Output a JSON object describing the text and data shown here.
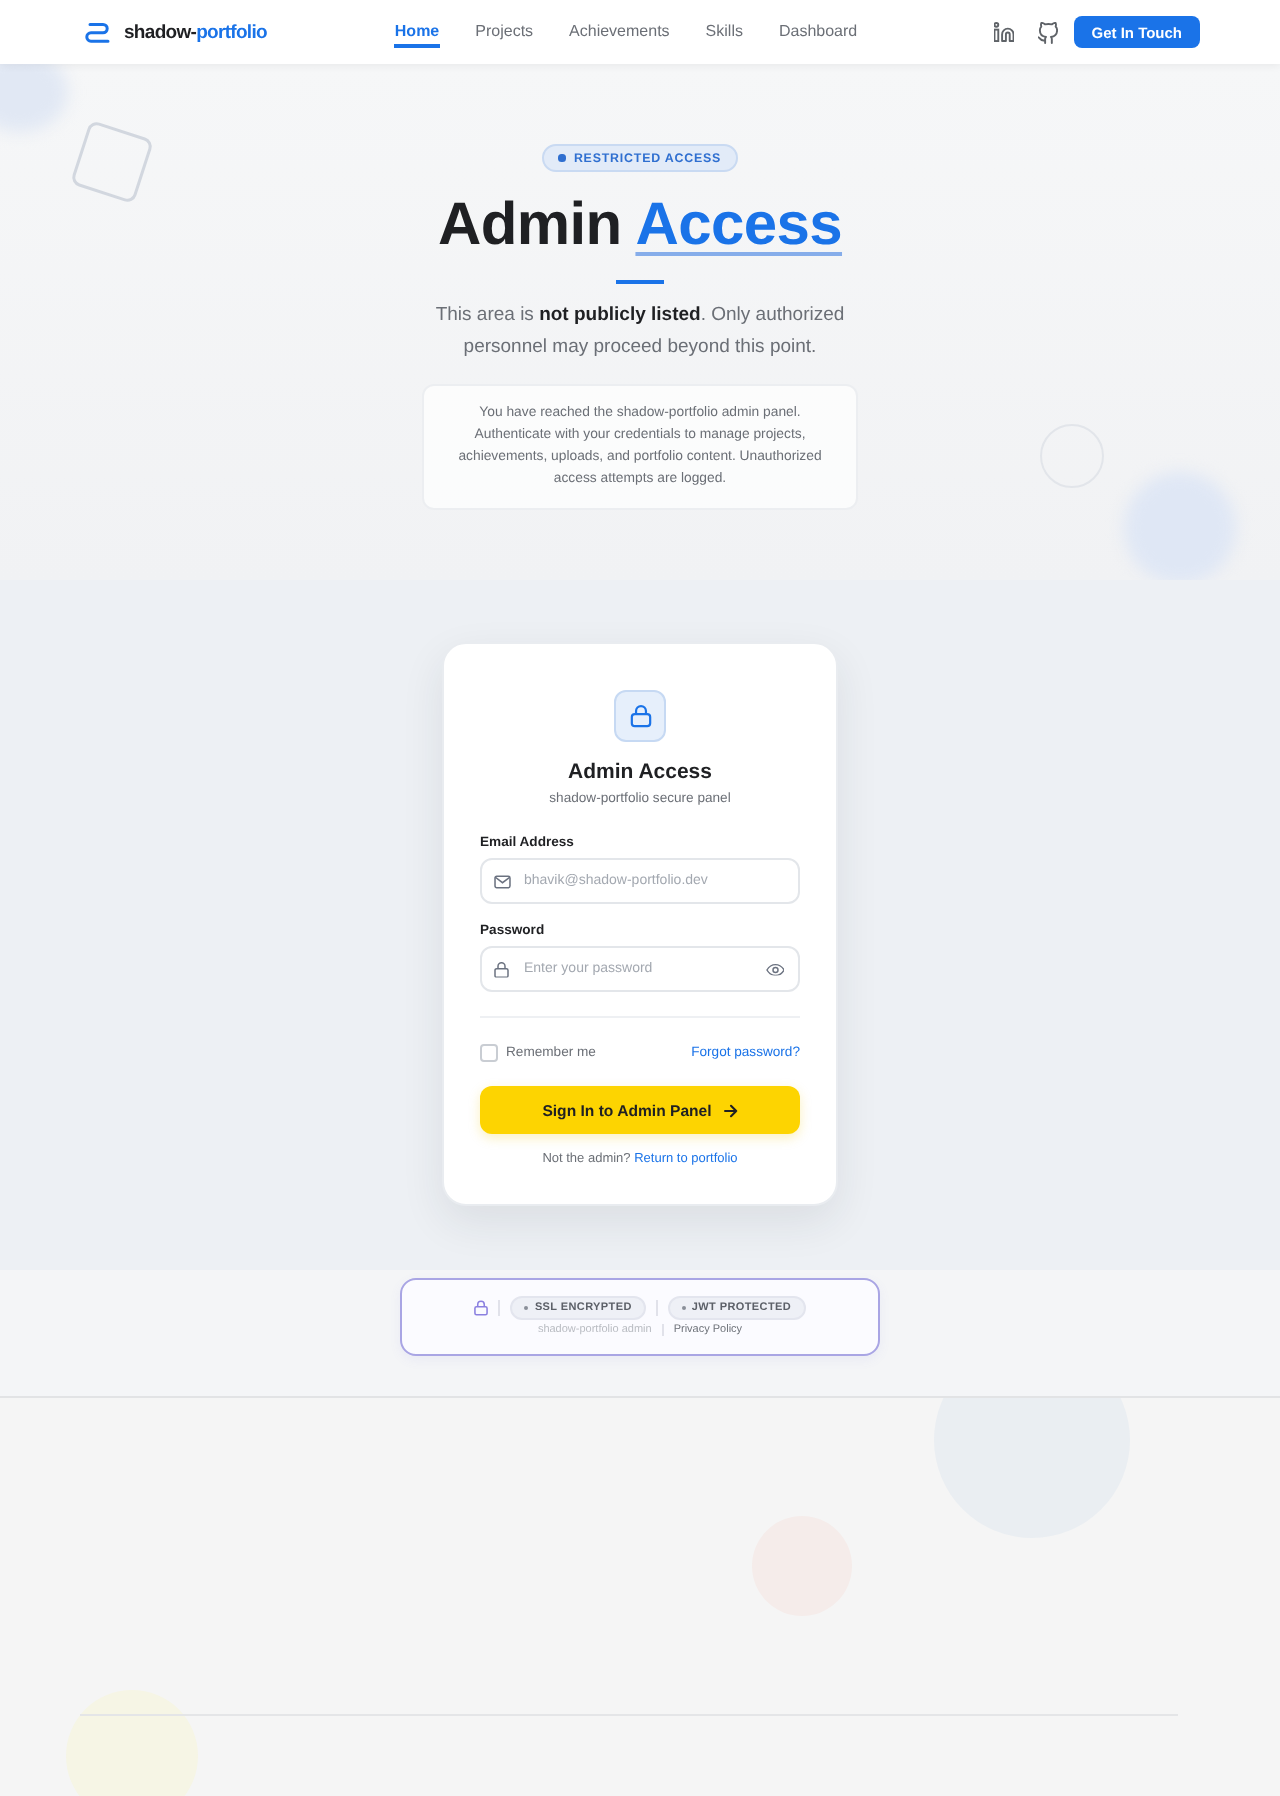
{
  "navbar": {
    "brand": {
      "text": "shadow-",
      "accent": "portfolio"
    },
    "items": [
      {
        "label": "Home",
        "selected": true
      },
      {
        "label": "Projects",
        "selected": false
      },
      {
        "label": "Achievements",
        "selected": false
      },
      {
        "label": "Skills",
        "selected": false
      },
      {
        "label": "Dashboard",
        "selected": false
      }
    ],
    "cta": "Get In Touch"
  },
  "hero": {
    "badge": "RESTRICTED ACCESS",
    "title": "Admin",
    "title_accent": "Access",
    "subtitle": "This area is **not publicly listed**. Only authorized personnel may proceed beyond this point.",
    "notice": "You have reached the shadow-portfolio admin panel. Authenticate with your credentials to manage projects, achievements, uploads, and portfolio content. Unauthorized access attempts are logged."
  },
  "login_card": {
    "title": "Admin Access",
    "subtitle": "shadow-portfolio secure panel",
    "fields": [
      {
        "kind": "email",
        "label": "Email Address",
        "placeholder": "bhavik@shadow-portfolio.dev"
      },
      {
        "kind": "password",
        "label": "Password",
        "placeholder": "Enter your password"
      }
    ],
    "remember": {
      "label": "Remember me",
      "checked": false
    },
    "forgot_link": "Forgot password?",
    "submit": "Sign In to Admin Panel",
    "footer_text": "Not the admin?",
    "footer_link": "Return to portfolio"
  },
  "security_bar": {
    "badges": [
      "SSL ENCRYPTED",
      "JWT PROTECTED"
    ],
    "caption": "shadow-portfolio admin",
    "link": "Privacy Policy"
  }
}
